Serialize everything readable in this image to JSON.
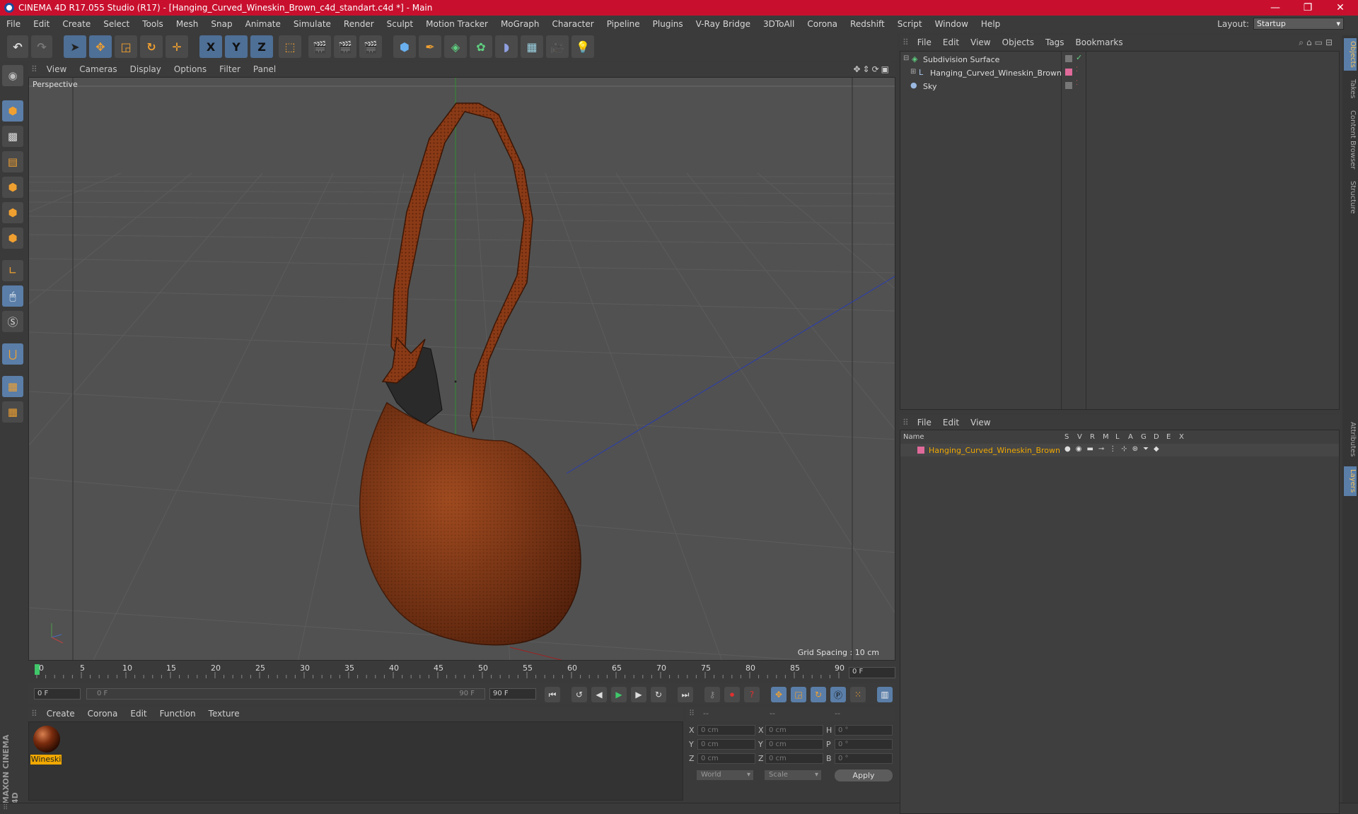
{
  "window": {
    "title": "CINEMA 4D R17.055 Studio (R17) - [Hanging_Curved_Wineskin_Brown_c4d_standart.c4d *] - Main",
    "minimize": "—",
    "maximize": "❐",
    "close": "✕"
  },
  "menubar": {
    "items": [
      "File",
      "Edit",
      "Create",
      "Select",
      "Tools",
      "Mesh",
      "Snap",
      "Animate",
      "Simulate",
      "Render",
      "Sculpt",
      "Motion Tracker",
      "MoGraph",
      "Character",
      "Pipeline",
      "Plugins",
      "V-Ray Bridge",
      "3DToAll",
      "Corona",
      "Redshift",
      "Script",
      "Window",
      "Help"
    ],
    "layout_label": "Layout:",
    "layout_value": "Startup"
  },
  "toolbar": {
    "axis_x": "X",
    "axis_y": "Y",
    "axis_z": "Z"
  },
  "viewport": {
    "menu": [
      "View",
      "Cameras",
      "Display",
      "Options",
      "Filter",
      "Panel"
    ],
    "label": "Perspective",
    "grid_spacing": "Grid Spacing : 10 cm"
  },
  "timeline": {
    "ticks": [
      "0",
      "5",
      "10",
      "15",
      "20",
      "25",
      "30",
      "35",
      "40",
      "45",
      "50",
      "55",
      "60",
      "65",
      "70",
      "75",
      "80",
      "85",
      "90"
    ],
    "current_frame": "0 F",
    "start_field": "0 F",
    "range_start": "0 F",
    "range_end": "90 F",
    "end_field": "90 F"
  },
  "material_manager": {
    "menu": [
      "Create",
      "Corona",
      "Edit",
      "Function",
      "Texture"
    ],
    "material_name": "Wineski"
  },
  "coordinates": {
    "head": [
      "--",
      "--",
      "--"
    ],
    "rows": [
      {
        "axis": "X",
        "pos": "0 cm",
        "axis2": "X",
        "size": "0 cm",
        "rot_label": "H",
        "rot": "0 °"
      },
      {
        "axis": "Y",
        "pos": "0 cm",
        "axis2": "Y",
        "size": "0 cm",
        "rot_label": "P",
        "rot": "0 °"
      },
      {
        "axis": "Z",
        "pos": "0 cm",
        "axis2": "Z",
        "size": "0 cm",
        "rot_label": "B",
        "rot": "0 °"
      }
    ],
    "mode_world": "World",
    "mode_scale": "Scale",
    "apply": "Apply"
  },
  "object_manager": {
    "menu": [
      "File",
      "Edit",
      "View",
      "Objects",
      "Tags",
      "Bookmarks"
    ],
    "objects": [
      {
        "name": "Subdivision Surface"
      },
      {
        "name": "Hanging_Curved_Wineskin_Brown"
      },
      {
        "name": "Sky"
      }
    ]
  },
  "layer_manager": {
    "menu": [
      "File",
      "Edit",
      "View"
    ],
    "columns": [
      "Name",
      "S",
      "V",
      "R",
      "M",
      "L",
      "A",
      "G",
      "D",
      "E",
      "X"
    ],
    "layer_name": "Hanging_Curved_Wineskin_Brown"
  },
  "right_tabs": [
    "Objects",
    "Takes",
    "Content Browser",
    "Structure",
    "Attributes",
    "Layers"
  ],
  "brand": "MAXON CINEMA 4D",
  "colors": {
    "accent": "#f0a800",
    "title_bar": "#c8102e",
    "layer_color": "#e06a9a",
    "wineskin": "#8a3a16"
  }
}
